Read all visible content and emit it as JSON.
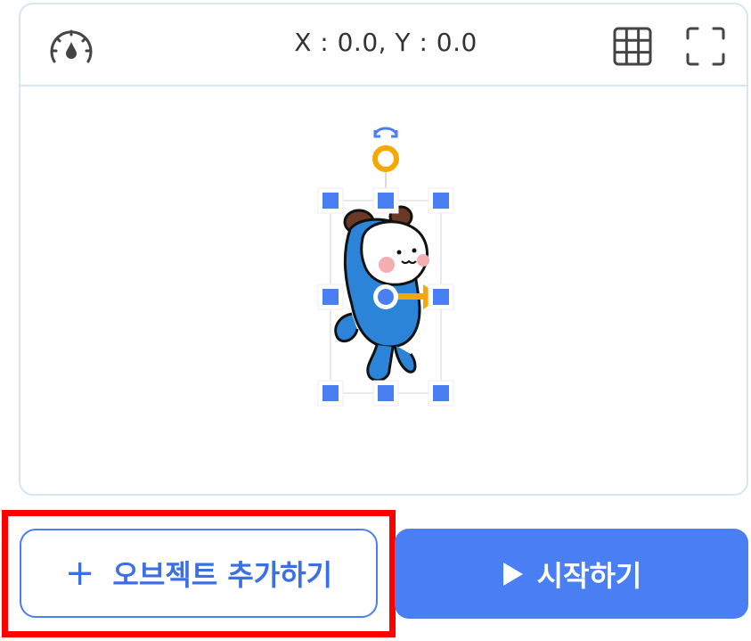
{
  "stage": {
    "coordinates": "X : 0.0, Y : 0.0",
    "speed_icon": "speedometer-icon",
    "grid_icon": "grid-icon",
    "fullscreen_icon": "fullscreen-icon"
  },
  "actions": {
    "add_object_label": "오브젝트 추가하기",
    "add_object_icon": "plus-icon",
    "start_label": "시작하기",
    "start_icon": "play-icon"
  },
  "colors": {
    "accent": "#4a7ff4",
    "stage_border": "#d6e6f4",
    "rotation_handle": "#f7a800",
    "highlight": "#ff0000"
  }
}
